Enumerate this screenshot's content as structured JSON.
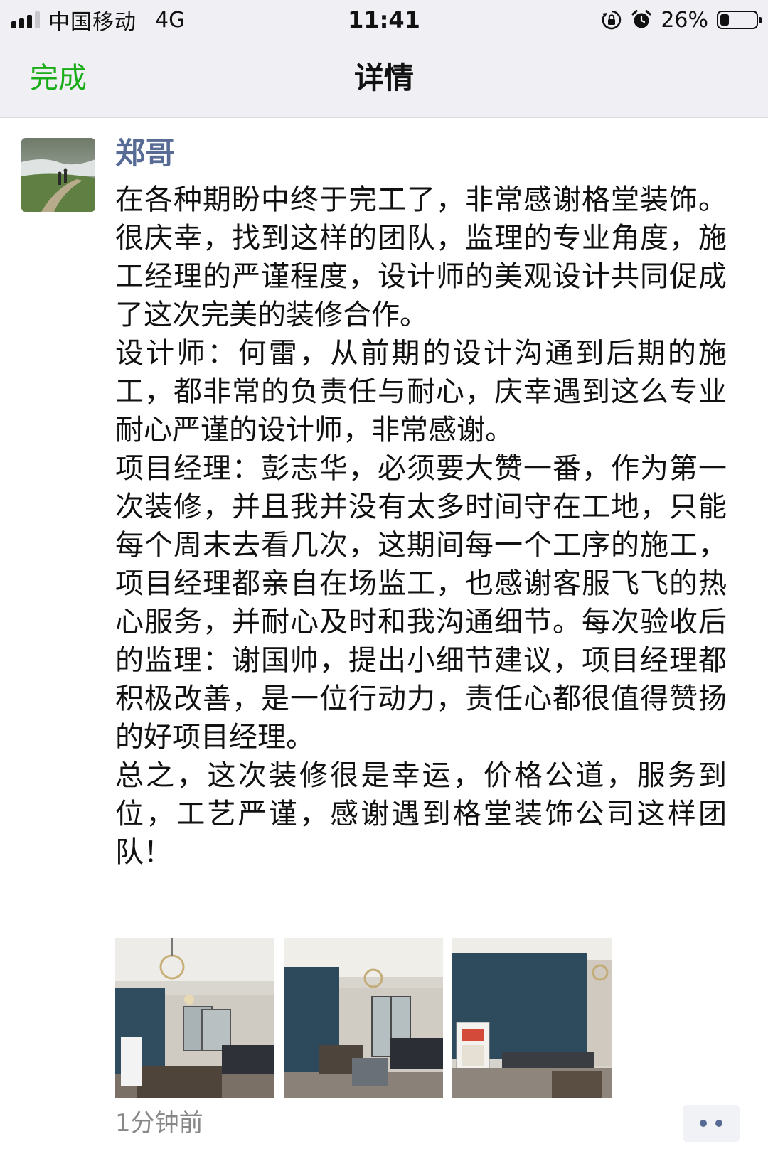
{
  "status_bar": {
    "carrier": "中国移动",
    "network": "4G",
    "time": "11:41",
    "battery_percent": "26%",
    "battery_level": 0.26,
    "icons": [
      "signal-icon",
      "orientation-lock-icon",
      "alarm-icon",
      "battery-icon"
    ]
  },
  "nav": {
    "done_label": "完成",
    "title": "详情"
  },
  "post": {
    "author": "郑哥",
    "paragraphs": [
      "在各种期盼中终于完工了，非常感谢格堂装饰。很庆幸，找到这样的团队，监理的专业角度，施工经理的严谨程度，设计师的美观设计共同促成了这次完美的装修合作。",
      "设计师：何雷，从前期的设计沟通到后期的施工，都非常的负责任与耐心，庆幸遇到这么专业耐心严谨的设计师，非常感谢。",
      "项目经理：彭志华，必须要大赞一番，作为第一次装修，并且我并没有太多时间守在工地，只能每个周末去看几次，这期间每一个工序的施工，项目经理都亲自在场监工，也感谢客服飞飞的热心服务，并耐心及时和我沟通细节。每次验收后的监理：谢国帅，提出小细节建议，项目经理都积极改善，是一位行动力，责任心都很值得赞扬的好项目经理。",
      "总之，这次装修很是幸运，价格公道，服务到位，工艺严谨，感谢遇到格堂装饰公司这样团队！"
    ],
    "photos": [
      "living-room-photo-1",
      "living-room-photo-2",
      "living-room-photo-3"
    ],
    "timestamp": "1分钟前"
  },
  "colors": {
    "accent_green": "#1aad19",
    "name_blue": "#576b95",
    "bar_background": "#efeff4",
    "timestamp_gray": "#888888"
  }
}
